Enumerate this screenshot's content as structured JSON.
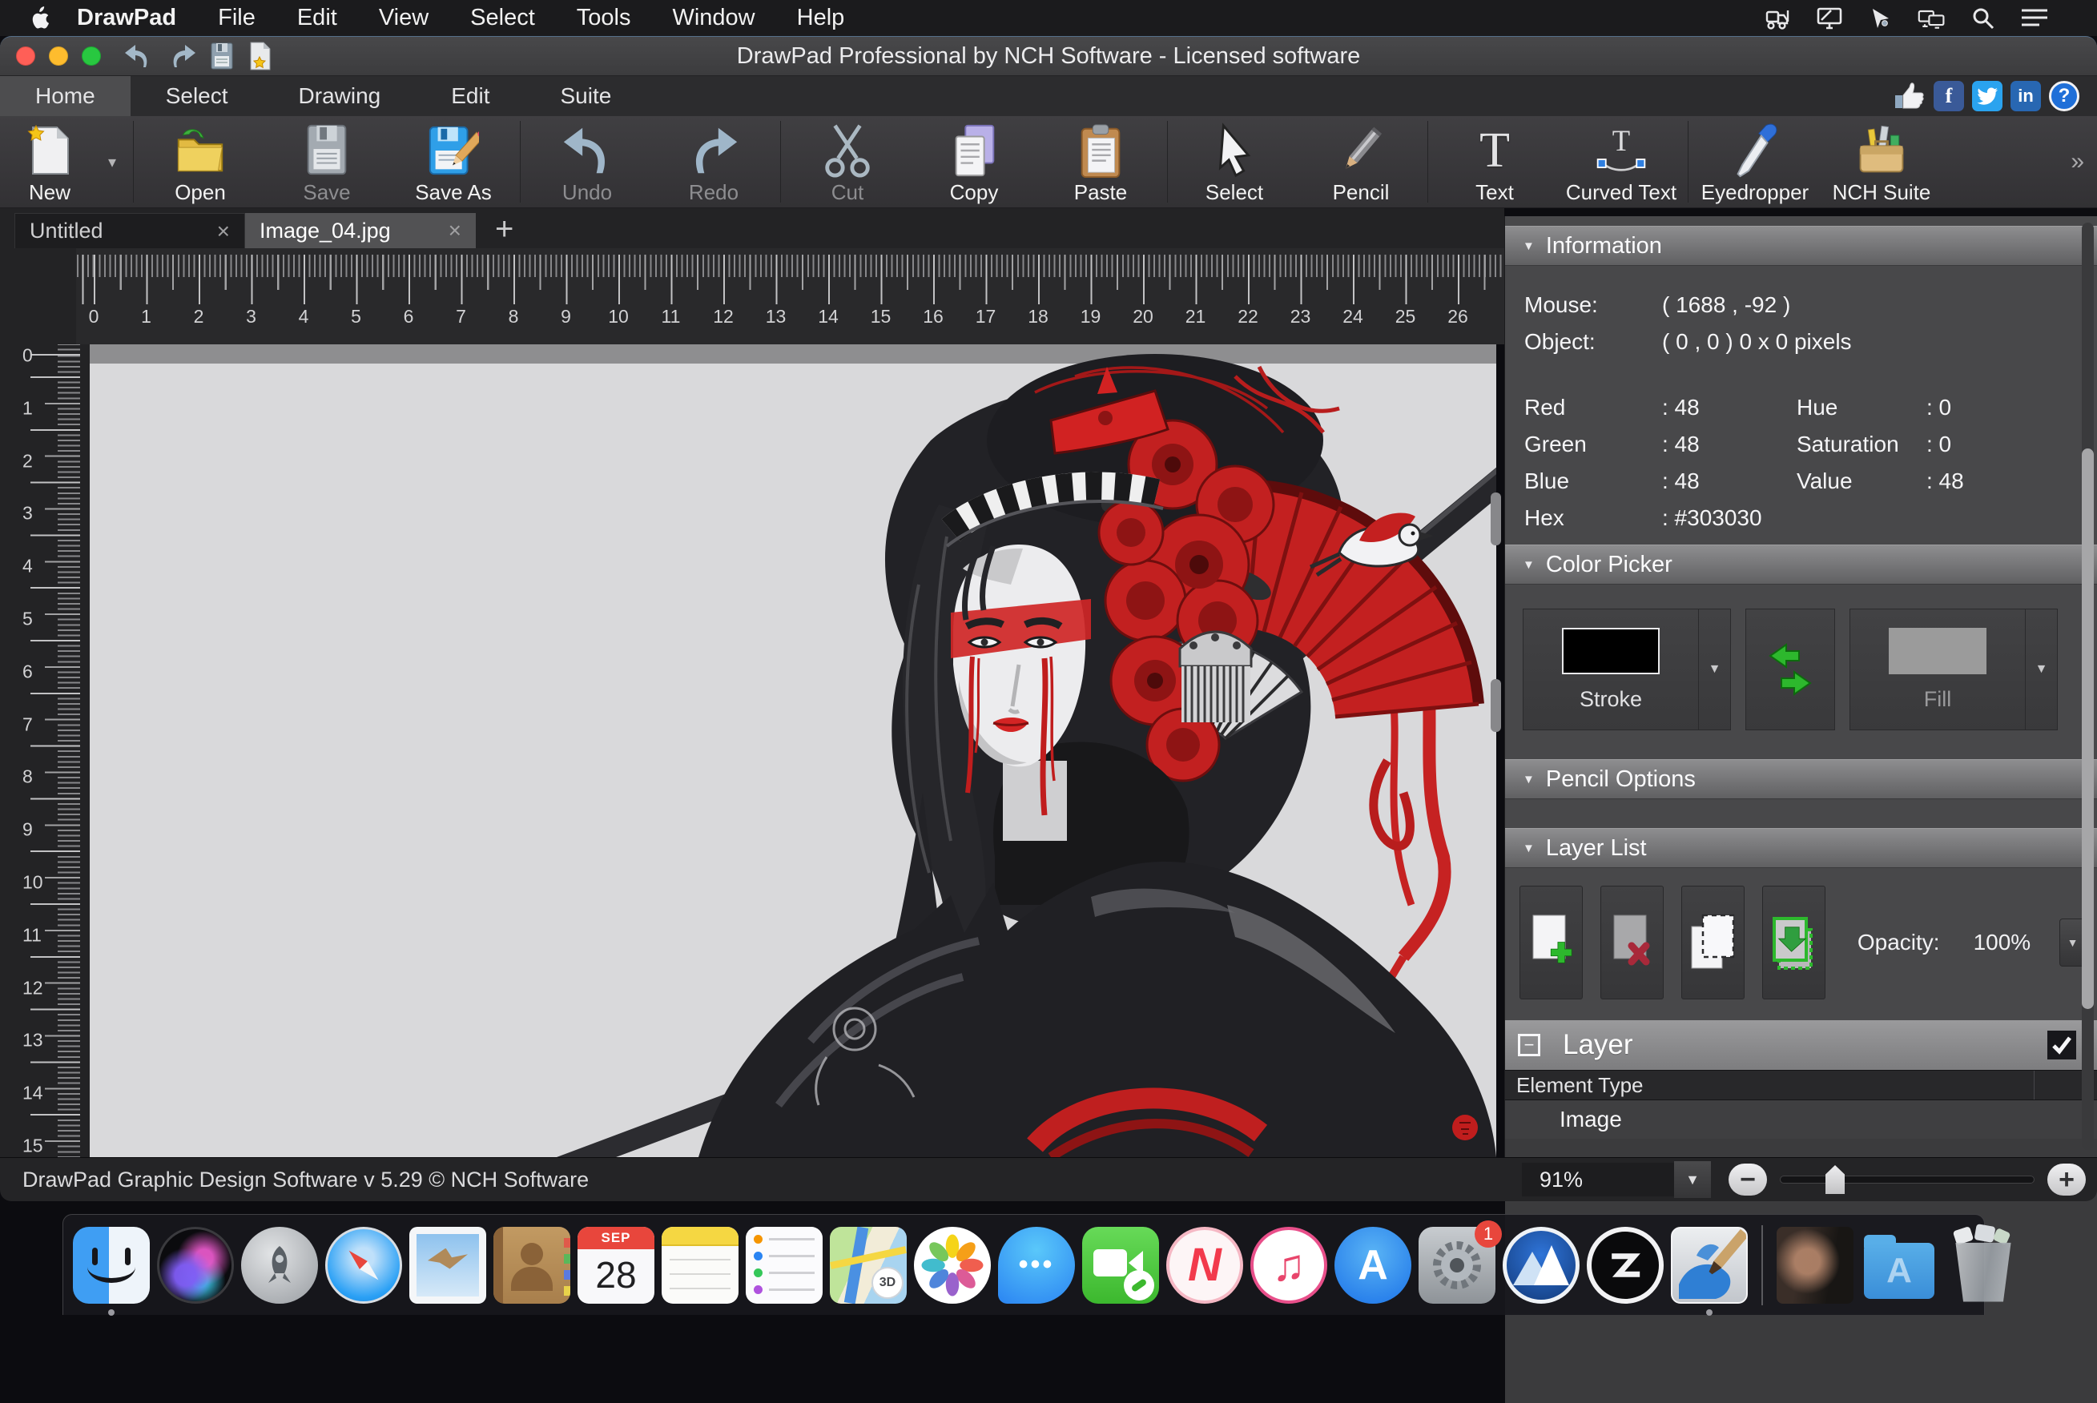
{
  "menu_bar": {
    "app_name": "DrawPad",
    "items": [
      "File",
      "Edit",
      "View",
      "Select",
      "Tools",
      "Window",
      "Help"
    ],
    "right_icons": [
      "forklift-icon",
      "display-icon",
      "pointer-icon",
      "displays-icon",
      "search-icon",
      "menu-list-icon"
    ]
  },
  "title_bar": {
    "title": "DrawPad Professional by NCH Software - Licensed software"
  },
  "ribbon": {
    "tabs": [
      "Home",
      "Select",
      "Drawing",
      "Edit",
      "Suite"
    ],
    "active_tab": "Home",
    "social_icons": [
      "like-icon",
      "facebook-icon",
      "twitter-icon",
      "linkedin-icon",
      "help-icon"
    ],
    "facebook_glyph": "f",
    "linkedin_glyph": "in",
    "help_glyph": "?"
  },
  "toolbar": {
    "new": "New",
    "open": "Open",
    "save": "Save",
    "save_as": "Save As",
    "undo": "Undo",
    "redo": "Redo",
    "cut": "Cut",
    "copy": "Copy",
    "paste": "Paste",
    "select": "Select",
    "pencil": "Pencil",
    "text": "Text",
    "curved_text": "Curved Text",
    "eyedropper": "Eyedropper",
    "nch_suite": "NCH Suite",
    "overflow_glyph": "»"
  },
  "document_tabs": {
    "tab1": "Untitled",
    "tab2": "Image_04.jpg",
    "close_glyph": "×",
    "new_tab_glyph": "+"
  },
  "rulers": {
    "h_numbers": [
      0,
      1,
      2,
      3,
      4,
      5,
      6,
      7,
      8,
      9,
      10,
      11,
      12,
      13,
      14,
      15,
      16,
      17,
      18,
      19,
      20,
      21,
      22,
      23,
      24,
      25,
      26
    ],
    "v_numbers": [
      0,
      1,
      2,
      3,
      4,
      5,
      6,
      7,
      8,
      9,
      10,
      11,
      12,
      13,
      14,
      15
    ]
  },
  "panel": {
    "information": {
      "header": "Information",
      "mouse_label": "Mouse:",
      "mouse_value": "( 1688 , -92 )",
      "object_label": "Object:",
      "object_value": "( 0 , 0 ) 0 x 0 pixels",
      "red_label": "Red",
      "red_value": ": 48",
      "green_label": "Green",
      "green_value": ": 48",
      "blue_label": "Blue",
      "blue_value": ": 48",
      "hex_label": "Hex",
      "hex_value": ": #303030",
      "hue_label": "Hue",
      "hue_value": ": 0",
      "sat_label": "Saturation",
      "sat_value": ": 0",
      "val_label": "Value",
      "val_value": ": 48"
    },
    "color_picker": {
      "header": "Color Picker",
      "stroke_label": "Stroke",
      "fill_label": "Fill",
      "stroke_color": "#000000",
      "fill_color": "#9b9b9b"
    },
    "pencil_options": {
      "header": "Pencil Options"
    },
    "layer_list": {
      "header": "Layer List",
      "buttons": [
        "add-layer-icon",
        "delete-layer-icon",
        "select-layer-icon",
        "merge-layer-icon"
      ],
      "opacity_label": "Opacity:",
      "opacity_value": "100%"
    },
    "layer_row": {
      "label": "Layer"
    },
    "element_table": {
      "header": "Element Type",
      "row1": "Image"
    }
  },
  "status_bar": {
    "app_info": "DrawPad Graphic Design Software v 5.29 © NCH Software",
    "zoom_value": "91%"
  },
  "dock": {
    "calendar_month": "SEP",
    "calendar_day": "28",
    "maps_badge": "3D",
    "prefs_badge": "1",
    "messages_dots": "•••",
    "news_glyph": "N",
    "music_glyph": "♫",
    "appstore_glyph": "A",
    "appsfolder_glyph": "A"
  },
  "colors": {
    "accent_red": "#c32020",
    "canvas_bg": "#d9d9db",
    "panel_bg": "#48484a",
    "hex_readout": "#303030"
  }
}
